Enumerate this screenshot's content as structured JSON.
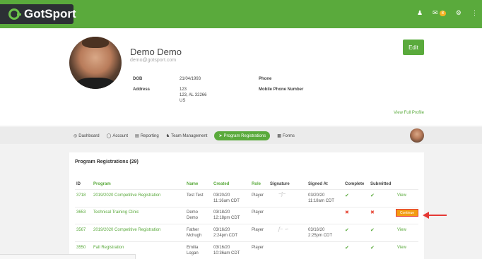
{
  "header": {
    "logo_text": "GotSport",
    "mail_badge": "8",
    "colors": {
      "brand_green": "#5aaa3c",
      "logo_bg": "#2c3034"
    },
    "icons": [
      "user-icon",
      "mail-icon",
      "gear-icon",
      "grid-icon"
    ]
  },
  "profile": {
    "name": "Demo Demo",
    "email": "demo@gotsport.com",
    "edit_label": "Edit",
    "dob_label": "DOB",
    "dob_value": "21/04/1993",
    "address_label": "Address",
    "address_line1": "123",
    "address_line2": "123, AL 32266",
    "address_line3": "US",
    "phone_label": "Phone",
    "mobile_label": "Mobile Phone Number",
    "view_full_profile": "View Full Profile"
  },
  "nav": {
    "items": [
      {
        "label": "Dashboard",
        "icon": "dashboard-icon"
      },
      {
        "label": "Account",
        "icon": "account-icon"
      },
      {
        "label": "Reporting",
        "icon": "report-icon"
      },
      {
        "label": "Team Management",
        "icon": "team-icon"
      },
      {
        "label": "Program Registrations",
        "icon": "send-icon",
        "active": true
      },
      {
        "label": "Forms",
        "icon": "forms-icon"
      }
    ]
  },
  "registrations": {
    "title": "Program Registrations (29)",
    "columns": [
      "ID",
      "Program",
      "Name",
      "Created",
      "Role",
      "Signature",
      "Signed At",
      "Complete",
      "Submitted"
    ],
    "rows": [
      {
        "id": "3718",
        "program": "2019/2020 Competitive Registration",
        "name1": "Test Test",
        "name2": "",
        "created1": "03/20/20",
        "created2": "11:16am CDT",
        "role": "Player",
        "signed1": "03/20/20",
        "signed2": "11:18am CDT",
        "complete": "check",
        "submitted": "check",
        "action": "View"
      },
      {
        "id": "3653",
        "program": "Technical Training Clinic",
        "name1": "Demo",
        "name2": "Demo",
        "created1": "03/18/20",
        "created2": "12:18pm CDT",
        "role": "Player",
        "signed1": "",
        "signed2": "",
        "complete": "cross",
        "submitted": "cross",
        "action": "Continue"
      },
      {
        "id": "3567",
        "program": "2019/2020 Competitive Registration",
        "name1": "Father",
        "name2": "Mchugh",
        "created1": "03/16/20",
        "created2": "2:24pm CDT",
        "role": "Player",
        "signed1": "03/16/20",
        "signed2": "2:25pm CDT",
        "complete": "check",
        "submitted": "check",
        "action": "View"
      },
      {
        "id": "3550",
        "program": "Fall Registration",
        "name1": "Emilia",
        "name2": "Logan",
        "created1": "03/16/20",
        "created2": "10:36am CDT",
        "role": "Player",
        "signed1": "",
        "signed2": "",
        "complete": "check",
        "submitted": "check",
        "action": "View"
      }
    ],
    "colors": {
      "continue_bg": "#f39c12",
      "highlight": "#e53935",
      "check": "#5aaa3c",
      "cross": "#e74c3c"
    }
  }
}
